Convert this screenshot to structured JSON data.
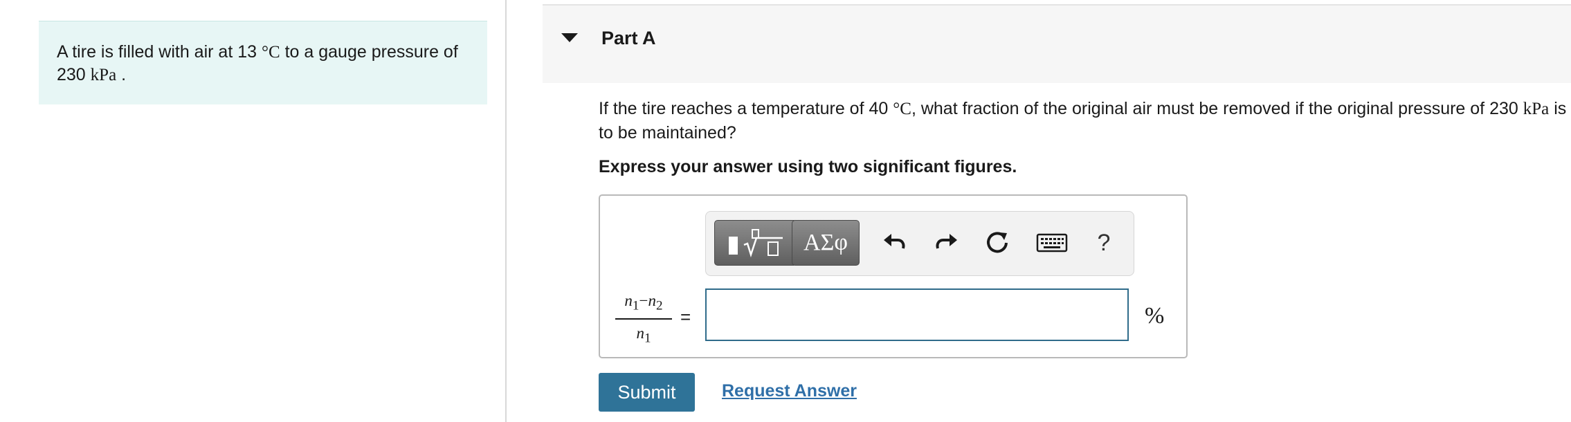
{
  "intro": {
    "text_before_temp": "A tire is filled with air at 13",
    "temp_unit": "°C",
    "text_middle": "to a gauge pressure of 230",
    "pressure_unit": "kPa",
    "text_end": "."
  },
  "part": {
    "title": "Part A",
    "question_before_temp": "If the tire reaches a temperature of 40",
    "temp_unit": "°C",
    "question_middle": ", what fraction of the original air must be removed if the original pressure of 230",
    "pressure_unit": "kPa",
    "question_end": "is to be maintained?",
    "instruction": "Express your answer using two significant figures."
  },
  "toolbar": {
    "greek_label": "ΑΣφ",
    "help_label": "?"
  },
  "answer": {
    "lhs_numerator_a": "n",
    "lhs_numerator_a_sub": "1",
    "minus": "−",
    "lhs_numerator_b": "n",
    "lhs_numerator_b_sub": "2",
    "lhs_denominator": "n",
    "lhs_denominator_sub": "1",
    "equals": "=",
    "value": "",
    "unit": "%"
  },
  "actions": {
    "submit_label": "Submit",
    "request_label": "Request Answer"
  },
  "colors": {
    "intro_bg": "#e7f6f5",
    "accent": "#2f7398",
    "link": "#2f6fa8"
  }
}
